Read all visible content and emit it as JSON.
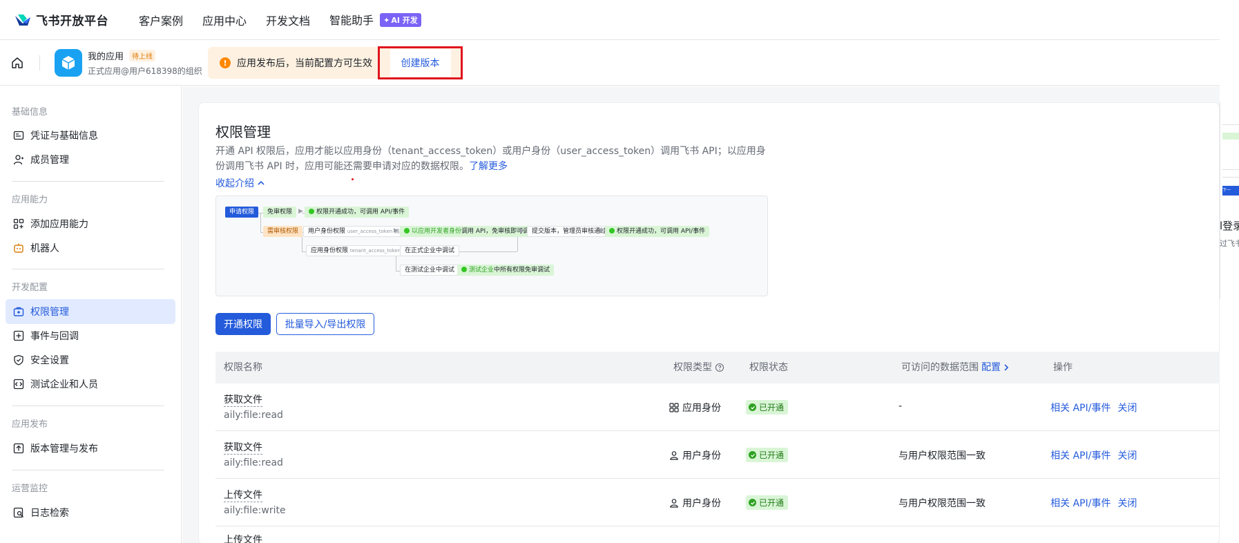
{
  "nav": {
    "brand": "飞书开放平台",
    "items": [
      "客户案例",
      "应用中心",
      "开发文档",
      "智能助手"
    ],
    "ai_badge": "AI 开发"
  },
  "appbar": {
    "app_name": "我的应用",
    "status": "待上线",
    "org": "正式应用@用户618398的组织",
    "notice": "应用发布后，当前配置方可生效",
    "create_version": "创建版本"
  },
  "sidebar": {
    "groups": [
      "基础信息",
      "应用能力",
      "开发配置",
      "应用发布",
      "运营监控"
    ],
    "items": [
      {
        "label": "凭证与基础信息",
        "icon": "credential-icon"
      },
      {
        "label": "成员管理",
        "icon": "member-icon"
      },
      {
        "label": "添加应用能力",
        "icon": "grid-add-icon"
      },
      {
        "label": "机器人",
        "icon": "robot-icon"
      },
      {
        "label": "权限管理",
        "icon": "permission-icon",
        "active": true
      },
      {
        "label": "事件与回调",
        "icon": "event-icon"
      },
      {
        "label": "安全设置",
        "icon": "shield-icon"
      },
      {
        "label": "测试企业和人员",
        "icon": "test-icon"
      },
      {
        "label": "版本管理与发布",
        "icon": "upload-icon"
      },
      {
        "label": "日志检索",
        "icon": "log-search-icon"
      }
    ]
  },
  "main": {
    "title": "权限管理",
    "desc_part1": "开通 API 权限后，应用才能以应用身份（tenant_access_token）或用户身份（user_access_token）调用飞书 API；以应用身份调用飞书 API 时，应用可能还需要申请对应的数据权限。",
    "learn_more": "了解更多",
    "collapse": "收起介绍",
    "btn_open": "开通权限",
    "btn_batch": "批量导入/导出权限"
  },
  "flow": {
    "apply": "申请权限",
    "no_review": "免审权限",
    "success1": "权限开通成功，可调用 API/事件",
    "need_review": "需审核权限",
    "user_perm": "用户身份权限",
    "user_token": "user_access_token",
    "call": "调用",
    "dev_call_pre": "以应用开发者身份",
    "dev_call_post": "调用 API，免审核即可调试",
    "submit": "提交版本，管理员审核通过",
    "success2": "权限开通成功，可调用 API/事件",
    "app_perm": "应用身份权限",
    "tenant_token": "tenant_access_token",
    "prod_debug": "在正式企业中调试",
    "test_debug": "在测试企业中调试",
    "test_free_pre": "测试企业",
    "test_free_post": "中所有权限免审调试"
  },
  "table": {
    "headers": {
      "name": "权限名称",
      "type": "权限类型",
      "status": "权限状态",
      "scope": "可访问的数据范围",
      "config": "配置",
      "ops": "操作"
    },
    "rows": [
      {
        "title": "获取文件",
        "code": "aily:file:read",
        "type": "应用身份",
        "status": "已开通",
        "scope": "-",
        "api": "相关 API/事件",
        "close": "关闭"
      },
      {
        "title": "获取文件",
        "code": "aily:file:read",
        "type": "用户身份",
        "status": "已开通",
        "scope": "与用户权限范围一致",
        "api": "相关 API/事件",
        "close": "关闭"
      },
      {
        "title": "上传文件",
        "code": "aily:file:write",
        "type": "用户身份",
        "status": "已开通",
        "scope": "与用户权限范围一致",
        "api": "相关 API/事件",
        "close": "关闭"
      },
      {
        "title": "上传文件"
      }
    ]
  },
  "peek": {
    "btn": "下一",
    "txt1": "l登录",
    "txt2": "过飞书"
  },
  "colors": {
    "primary": "#245bdb",
    "highlight": "#e0141e",
    "notice_bg": "#fef1e1",
    "success": "#2ea121"
  }
}
